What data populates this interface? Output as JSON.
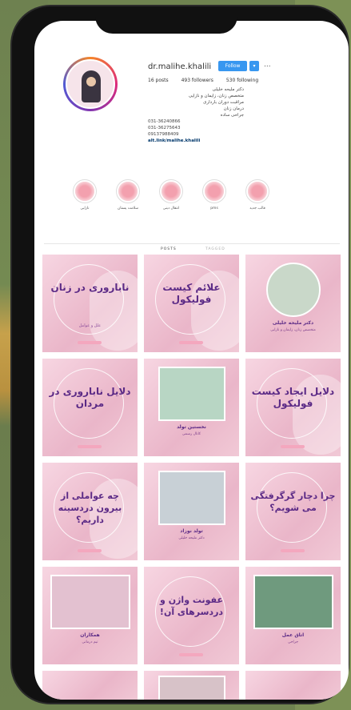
{
  "profile": {
    "username": "dr.malihe.khalili",
    "follow_label": "Follow",
    "dropdown_icon": "chevron-down-icon",
    "more_label": "...",
    "stats": {
      "posts": "16 posts",
      "followers": "493 followers",
      "following": "530 following"
    },
    "bio": [
      "دکتر ملیحه خلیلی",
      "متخصص زنان، زایمان و نازایی",
      "مراقبت دوران بارداری",
      "درمان زنان",
      "جراحی ساده",
      "031-36240866",
      "031-36275643",
      "09137988409"
    ],
    "link": "alt.link/malihe.khalili"
  },
  "highlights": [
    {
      "label": "قالب جدید"
    },
    {
      "label": "pms"
    },
    {
      "label": "انتقال دینی"
    },
    {
      "label": "سلامت پستان"
    },
    {
      "label": "نازایی"
    }
  ],
  "tabs": {
    "posts": "POSTS",
    "tagged": "TAGGED"
  },
  "posts": [
    {
      "kind": "text",
      "title": "ناباروری در زنان",
      "sub": "علل و عوامل"
    },
    {
      "kind": "text",
      "title": "علائم کیست فولیکول",
      "sub": ""
    },
    {
      "kind": "photo",
      "title": "دکتر ملیحه خلیلی",
      "sub": "متخصص زنان، زایمان و نازایی"
    },
    {
      "kind": "text",
      "title": "دلایل ناباروری در مردان",
      "sub": ""
    },
    {
      "kind": "photo",
      "title": "نخستین تولد",
      "sub": "کانال رسمی"
    },
    {
      "kind": "text",
      "title": "دلایل ایجاد کیست فولیکول",
      "sub": ""
    },
    {
      "kind": "text",
      "title": "چه عواملی از بیرون دردسینه داریم؟",
      "sub": ""
    },
    {
      "kind": "photo",
      "title": "تولد نوزاد",
      "sub": "دکتر ملیحه خلیلی"
    },
    {
      "kind": "text",
      "title": "چرا دچار گرگرفتگی می شویم؟",
      "sub": ""
    },
    {
      "kind": "photo",
      "title": "همکاران",
      "sub": "تیم درمانی"
    },
    {
      "kind": "text",
      "title": "عفونت واژن و دردسرهای آن!",
      "sub": ""
    },
    {
      "kind": "photo",
      "title": "اتاق عمل",
      "sub": "جراحی"
    }
  ],
  "colors": {
    "accent": "#3897f0",
    "tile_text": "#5b2a86",
    "tile_bg": "#f2c8d7"
  }
}
